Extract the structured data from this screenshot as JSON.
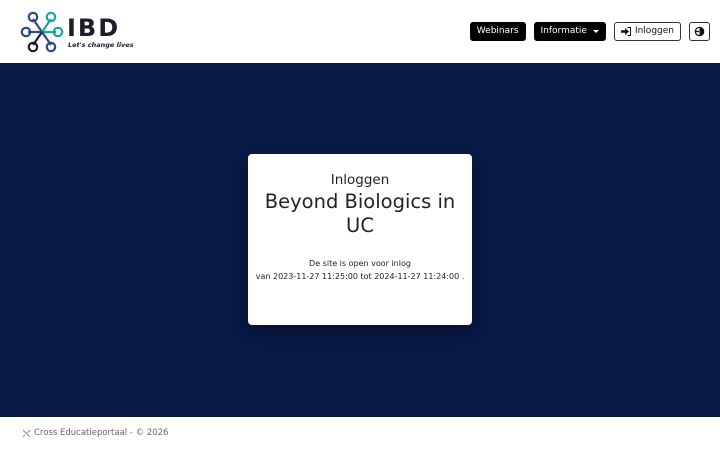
{
  "header": {
    "logo": {
      "text": "IBD",
      "tagline": "Let's change lives"
    },
    "nav": {
      "webinars_label": "Webinars",
      "informatie_label": "Informatie",
      "login_label": "Inloggen"
    }
  },
  "login_card": {
    "subtitle": "Inloggen",
    "title": "Beyond Biologics in UC",
    "message_line1": "De site is open voor inlog",
    "message_line2": "van 2023-11-27 11:25:00 tot 2024-11-27 11:24:00 ."
  },
  "footer": {
    "text": "Cross Educatieportaal - © 2026"
  },
  "colors": {
    "main_background": "#081a48",
    "card_background": "#ffffff",
    "nav_dark": "#000000"
  },
  "icons": {
    "login": "sign-in-icon",
    "contrast": "contrast-toggle-icon",
    "footer": "cross-logo-icon",
    "dropdown": "caret-down-icon"
  }
}
